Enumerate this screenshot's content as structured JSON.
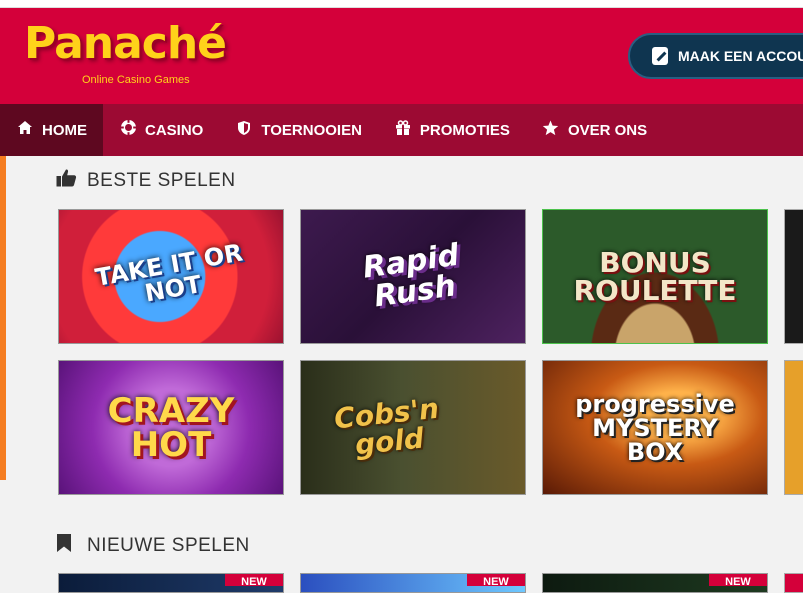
{
  "header": {
    "logo_text": "Panaché",
    "logo_subtitle": "Online Casino Games",
    "account_button": "MAAK EEN ACCOUNT"
  },
  "nav": {
    "items": [
      {
        "label": "HOME",
        "icon": "home-icon"
      },
      {
        "label": "CASINO",
        "icon": "chip-icon"
      },
      {
        "label": "TOERNOOIEN",
        "icon": "shield-icon"
      },
      {
        "label": "PROMOTIES",
        "icon": "gift-icon"
      },
      {
        "label": "OVER ONS",
        "icon": "star-icon"
      }
    ]
  },
  "sections": {
    "best": {
      "title": "BESTE SPELEN",
      "icon": "thumbs-up-icon"
    },
    "new": {
      "title": "NIEUWE SPELEN",
      "icon": "bookmark-icon"
    }
  },
  "games": {
    "best": [
      {
        "name": "TAKE IT OR NOT"
      },
      {
        "name": "Rapid Rush"
      },
      {
        "name": "BONUS ROULETTE"
      },
      {
        "name": "CRAZY HOT"
      },
      {
        "name": "Cobs'n gold"
      },
      {
        "name": "progressive MYSTERY BOX"
      }
    ],
    "new_badge": "NEW"
  },
  "colors": {
    "header_red": "#d4003a",
    "nav_dark_red": "#9c0a33",
    "nav_active": "#5e0820",
    "account_navy": "#0f3550",
    "logo_yellow": "#ffd21a",
    "accent_orange": "#f57d21"
  }
}
